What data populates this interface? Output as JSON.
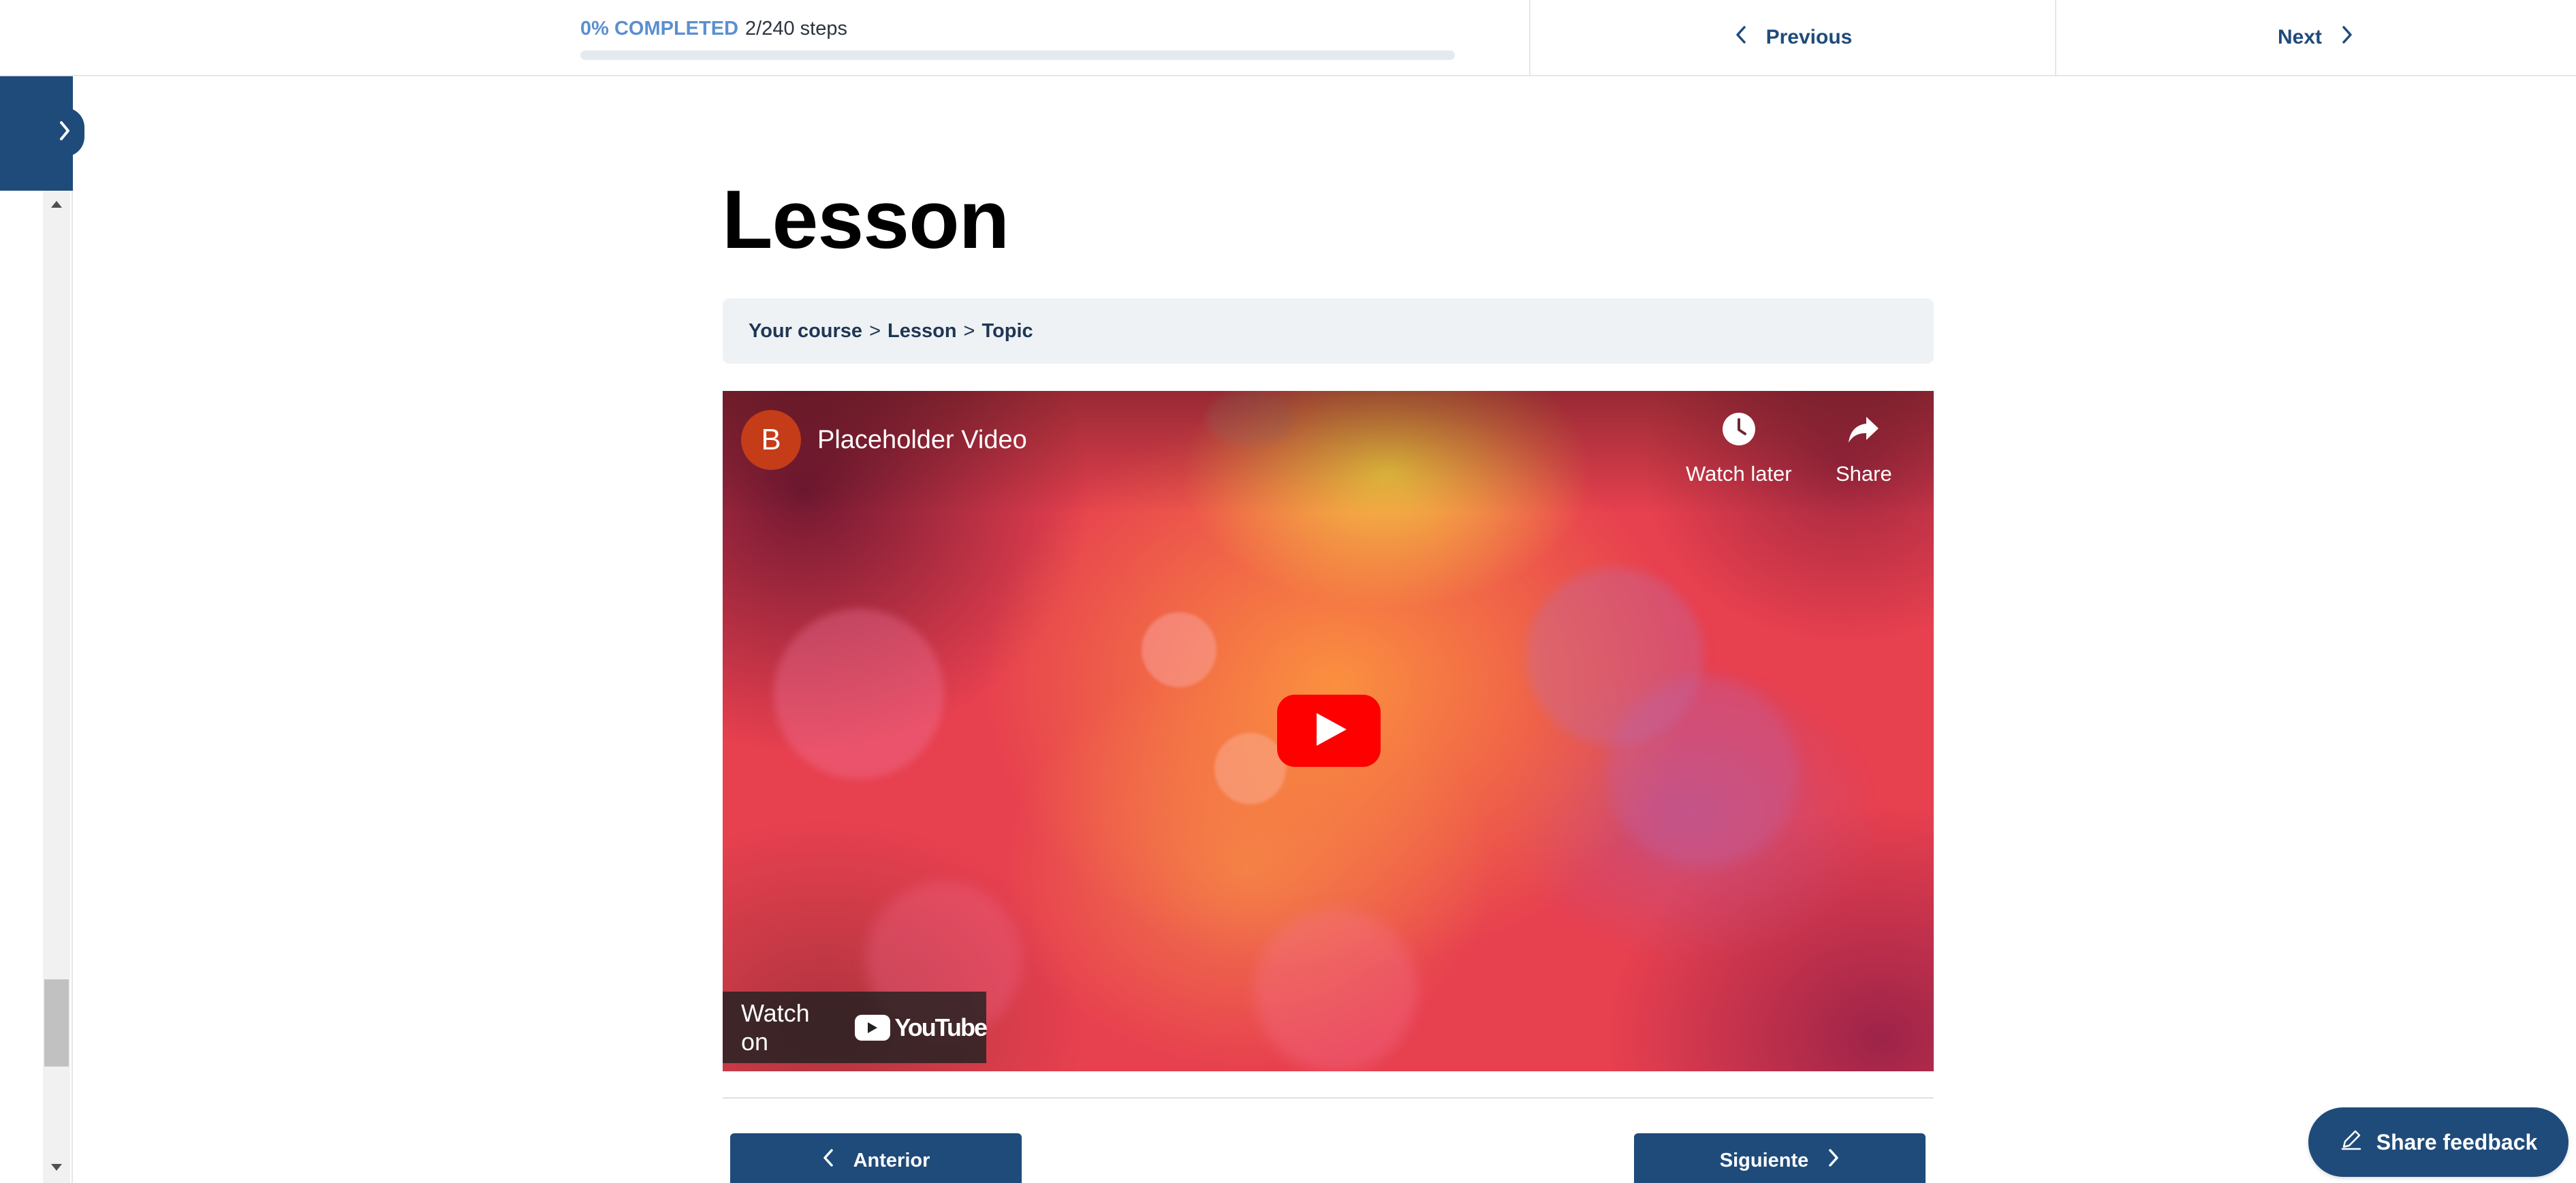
{
  "header": {
    "progress": {
      "percent_label": "0% COMPLETED",
      "steps_label": "2/240 steps",
      "fraction": 0.0
    },
    "previous_label": "Previous",
    "next_label": "Next"
  },
  "sidebar": {
    "toggle_icon": "chevron-right-icon"
  },
  "main": {
    "title": "Lesson",
    "breadcrumb": [
      "Your course",
      "Lesson",
      "Topic"
    ],
    "breadcrumb_separator": ">"
  },
  "video": {
    "channel_initial": "B",
    "title": "Placeholder Video",
    "watch_later_label": "Watch later",
    "share_label": "Share",
    "watch_on_label": "Watch on",
    "youtube_wordmark": "YouTube"
  },
  "footer_nav": {
    "previous_label": "Anterior",
    "next_label": "Siguiente"
  },
  "feedback": {
    "label": "Share feedback",
    "icon": "pencil-icon"
  },
  "colors": {
    "brand": "#1f4b7a",
    "progress": "#5b8fd0",
    "breadcrumb_bg": "#eef2f5",
    "youtube_red": "#ff0000"
  }
}
